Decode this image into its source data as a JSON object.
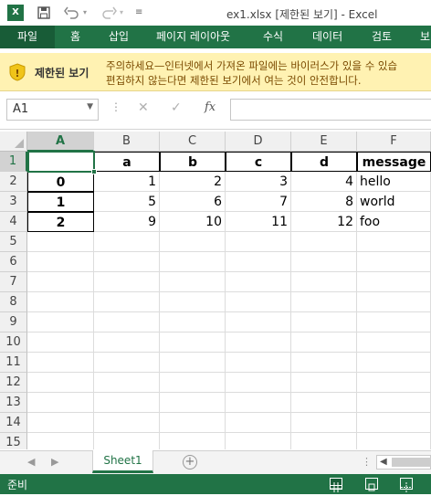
{
  "titlebar": {
    "title": "ex1.xlsx  [제한된 보기] - Excel",
    "quick_access": [
      "save-icon",
      "undo-icon",
      "redo-icon",
      "customize-icon"
    ]
  },
  "ribbon": {
    "tabs": [
      "파일",
      "홈",
      "삽입",
      "페이지 레이아웃",
      "수식",
      "데이터",
      "검토",
      "보"
    ]
  },
  "protected_view": {
    "label": "제한된 보기",
    "line1": "주의하세요—인터넷에서 가져온 파일에는 바이러스가 있을 수 있습",
    "line2": "편집하지 않는다면 제한된 보기에서 여는 것이 안전합니다."
  },
  "formula_bar": {
    "name_box": "A1",
    "fx": "fx",
    "value": ""
  },
  "grid": {
    "columns": [
      "A",
      "B",
      "C",
      "D",
      "E",
      "F"
    ],
    "selected_column": "A",
    "rows": [
      "1",
      "2",
      "3",
      "4",
      "5",
      "6",
      "7",
      "8",
      "9",
      "10",
      "11",
      "12",
      "13",
      "14",
      "15"
    ],
    "selected_row": "1",
    "header_row": [
      "",
      "a",
      "b",
      "c",
      "d",
      "message"
    ],
    "data": [
      [
        "0",
        "1",
        "2",
        "3",
        "4",
        "hello"
      ],
      [
        "1",
        "5",
        "6",
        "7",
        "8",
        "world"
      ],
      [
        "2",
        "9",
        "10",
        "11",
        "12",
        "foo"
      ]
    ]
  },
  "sheets": {
    "tabs": [
      "Sheet1"
    ],
    "active": "Sheet1"
  },
  "status": {
    "ready": "준비"
  },
  "colors": {
    "excel_green": "#217346",
    "warning_bg": "#fff2b2"
  }
}
